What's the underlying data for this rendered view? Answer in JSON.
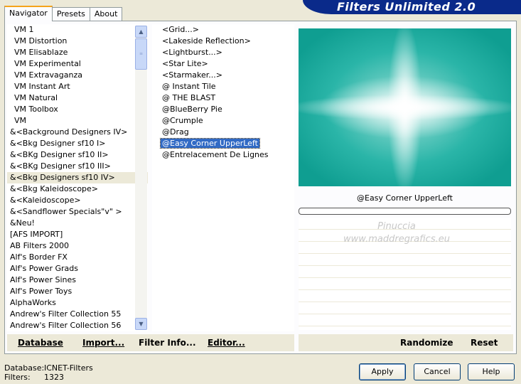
{
  "app": {
    "title": "Filters Unlimited 2.0"
  },
  "tabs": [
    {
      "label": "Navigator"
    },
    {
      "label": "Presets"
    },
    {
      "label": "About"
    }
  ],
  "categories": [
    {
      "label": "VM 1"
    },
    {
      "label": "VM Distortion"
    },
    {
      "label": "VM Elisablaze"
    },
    {
      "label": "VM Experimental"
    },
    {
      "label": "VM Extravaganza"
    },
    {
      "label": "VM Instant Art"
    },
    {
      "label": "VM Natural"
    },
    {
      "label": "VM Toolbox"
    },
    {
      "label": "VM"
    },
    {
      "label": "&<Background Designers IV>"
    },
    {
      "label": "&<Bkg Designer sf10 I>"
    },
    {
      "label": "&<BKg Designer sf10 II>"
    },
    {
      "label": "&<BKg Designer sf10 III>"
    },
    {
      "label": "&<Bkg Designers sf10 IV>"
    },
    {
      "label": "&<Bkg Kaleidoscope>"
    },
    {
      "label": "&<Kaleidoscope>"
    },
    {
      "label": "&<Sandflower Specials\"v\" >"
    },
    {
      "label": "&Neu!"
    },
    {
      "label": "[AFS IMPORT]"
    },
    {
      "label": "AB Filters 2000"
    },
    {
      "label": "Alf's Border FX"
    },
    {
      "label": "Alf's Power Grads"
    },
    {
      "label": "Alf's Power Sines"
    },
    {
      "label": "Alf's Power Toys"
    },
    {
      "label": "AlphaWorks"
    },
    {
      "label": "Andrew's Filter Collection 55"
    },
    {
      "label": "Andrew's Filter Collection 56"
    }
  ],
  "filters": [
    {
      "label": "<Grid...>"
    },
    {
      "label": "<Lakeside Reflection>"
    },
    {
      "label": "<Lightburst...>"
    },
    {
      "label": "<Star Lite>"
    },
    {
      "label": "<Starmaker...>"
    },
    {
      "label": "@ Instant Tile"
    },
    {
      "label": "@ THE BLAST"
    },
    {
      "label": "@BlueBerry Pie"
    },
    {
      "label": "@Crumple"
    },
    {
      "label": "@Drag"
    },
    {
      "label": "@Easy Corner UpperLeft"
    },
    {
      "label": "@Entrelacement De Lignes"
    }
  ],
  "preview": {
    "filter_name": "@Easy Corner UpperLeft"
  },
  "watermark": {
    "line1": "Pinuccia",
    "line2": "www.maddregrafics.eu"
  },
  "toolbar": {
    "database": "Database",
    "import": "Import...",
    "filter_info": "Filter Info...",
    "editor": "Editor...",
    "randomize": "Randomize",
    "reset": "Reset"
  },
  "status": {
    "database_label": "Database:",
    "database_value": "ICNET-Filters",
    "filters_label": "Filters:",
    "filters_value": "1323"
  },
  "dialog_buttons": {
    "apply": "Apply",
    "cancel": "Cancel",
    "help": "Help"
  },
  "selection": {
    "category_index": 13,
    "filter_index": 10
  }
}
